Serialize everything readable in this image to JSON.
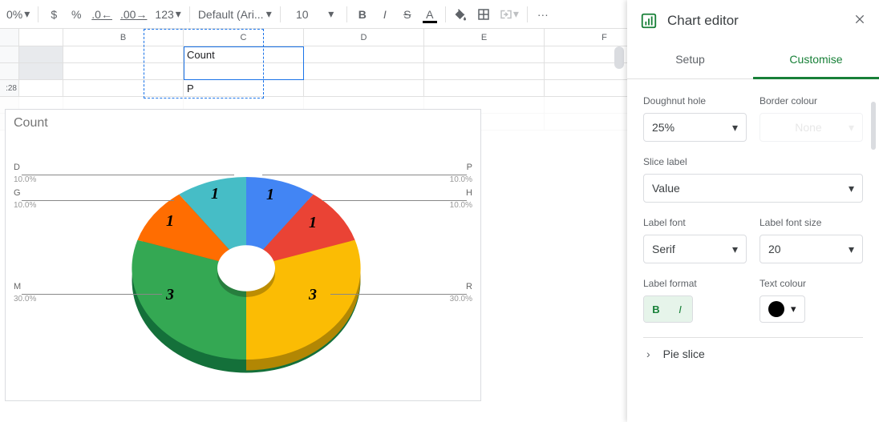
{
  "toolbar": {
    "zoom": "0%",
    "currency": "$",
    "percent": "%",
    "dec_less": ".0",
    "dec_more": ".00",
    "fmt123": "123",
    "font": "Default (Ari...",
    "size": "10",
    "bold": "B",
    "italic": "I",
    "strike": "S",
    "textcolor": "A",
    "more": "···",
    "collapse": "ᐱ"
  },
  "columns": {
    "B": "B",
    "C": "C",
    "D": "D",
    "E": "E",
    "F": "F"
  },
  "col_widths": {
    "A": 55,
    "B": 150,
    "C": 150,
    "D": 150,
    "E": 150,
    "F": 150
  },
  "cells": {
    "c1": "Count",
    "c3": "P",
    "row3_hdr": ":28"
  },
  "chart_data": {
    "type": "pie",
    "title": "Count",
    "doughnut_hole": 0.25,
    "is_3d": true,
    "series": [
      {
        "name": "P",
        "value": 1,
        "pct": 10.0,
        "color": "#4285f4"
      },
      {
        "name": "H",
        "value": 1,
        "pct": 10.0,
        "color": "#ea4335"
      },
      {
        "name": "R",
        "value": 3,
        "pct": 30.0,
        "color": "#fbbc04"
      },
      {
        "name": "M",
        "value": 3,
        "pct": 30.0,
        "color": "#34a853"
      },
      {
        "name": "G",
        "value": 1,
        "pct": 10.0,
        "color": "#ff6d01"
      },
      {
        "name": "D",
        "value": 1,
        "pct": 10.0,
        "color": "#46bdc6"
      }
    ],
    "slice_label_mode": "Value",
    "label_font": "Serif",
    "label_font_size": 20,
    "label_bold": true,
    "label_italic": true
  },
  "sidebar": {
    "title": "Chart editor",
    "tabs": {
      "setup": "Setup",
      "customise": "Customise"
    },
    "labels": {
      "doughnut_hole": "Doughnut hole",
      "border_colour": "Border colour",
      "slice_label": "Slice label",
      "label_font": "Label font",
      "label_font_size": "Label font size",
      "label_format": "Label format",
      "text_colour": "Text colour",
      "pie_slice": "Pie slice"
    },
    "values": {
      "doughnut_hole": "25%",
      "border_colour": "None",
      "slice_label": "Value",
      "label_font": "Serif",
      "label_font_size": "20",
      "bold": "B",
      "italic": "I"
    }
  }
}
